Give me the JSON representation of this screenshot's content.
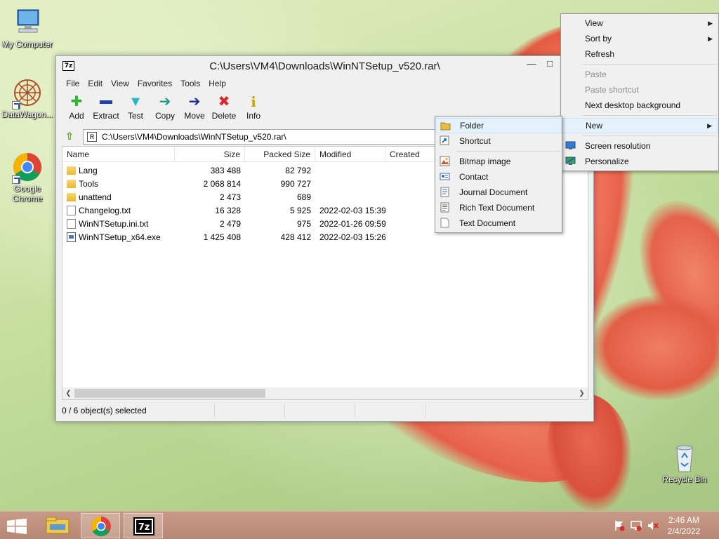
{
  "desktop": {
    "icons": [
      {
        "label": "My Computer"
      },
      {
        "label": "DataWagon..."
      },
      {
        "label": "Google Chrome"
      },
      {
        "label": "Recycle Bin"
      }
    ]
  },
  "window": {
    "title": "C:\\Users\\VM4\\Downloads\\WinNTSetup_v520.rar\\",
    "app_icon_text": "7z",
    "menu": [
      "File",
      "Edit",
      "View",
      "Favorites",
      "Tools",
      "Help"
    ],
    "toolbar": [
      {
        "label": "Add",
        "icon": "plus-icon",
        "color": "#2eb82e"
      },
      {
        "label": "Extract",
        "icon": "minus-icon",
        "color": "#1f3fb0"
      },
      {
        "label": "Test",
        "icon": "check-icon",
        "color": "#2ab7c0"
      },
      {
        "label": "Copy",
        "icon": "copy-arrow-icon",
        "color": "#1e9a86"
      },
      {
        "label": "Move",
        "icon": "move-arrow-icon",
        "color": "#1b2a8c"
      },
      {
        "label": "Delete",
        "icon": "x-icon",
        "color": "#d42a2a"
      },
      {
        "label": "Info",
        "icon": "info-icon",
        "color": "#c9a500"
      }
    ],
    "address": "C:\\Users\\VM4\\Downloads\\WinNTSetup_v520.rar\\",
    "columns": {
      "name": "Name",
      "size": "Size",
      "packed": "Packed Size",
      "modified": "Modified",
      "created": "Created"
    },
    "files": [
      {
        "name": "Lang",
        "type": "folder",
        "size": "383 488",
        "packed": "82 792",
        "modified": ""
      },
      {
        "name": "Tools",
        "type": "folder",
        "size": "2 068 814",
        "packed": "990 727",
        "modified": ""
      },
      {
        "name": "unattend",
        "type": "folder",
        "size": "2 473",
        "packed": "689",
        "modified": ""
      },
      {
        "name": "Changelog.txt",
        "type": "text",
        "size": "16 328",
        "packed": "5 925",
        "modified": "2022-02-03 15:39"
      },
      {
        "name": "WinNTSetup.ini.txt",
        "type": "text",
        "size": "2 479",
        "packed": "975",
        "modified": "2022-01-26 09:59"
      },
      {
        "name": "WinNTSetup_x64.exe",
        "type": "exe",
        "size": "1 425 408",
        "packed": "428 412",
        "modified": "2022-02-03 15:26"
      }
    ],
    "status": "0 / 6 object(s) selected"
  },
  "desktop_menu": {
    "items": [
      {
        "label": "View",
        "submenu": true,
        "disabled": false
      },
      {
        "label": "Sort by",
        "submenu": true,
        "disabled": false
      },
      {
        "label": "Refresh",
        "submenu": false,
        "disabled": false
      },
      {
        "sep": true
      },
      {
        "label": "Paste",
        "submenu": false,
        "disabled": true
      },
      {
        "label": "Paste shortcut",
        "submenu": false,
        "disabled": true
      },
      {
        "label": "Next desktop background",
        "submenu": false,
        "disabled": false
      },
      {
        "sep": true
      },
      {
        "label": "New",
        "submenu": true,
        "disabled": false,
        "highlighted": true
      },
      {
        "sep": true
      },
      {
        "label": "Screen resolution",
        "submenu": false,
        "disabled": false,
        "icon": "monitor-icon"
      },
      {
        "label": "Personalize",
        "submenu": false,
        "disabled": false,
        "icon": "personalize-icon"
      }
    ]
  },
  "new_menu": {
    "items": [
      {
        "label": "Folder",
        "icon": "folder-icon",
        "highlighted": true
      },
      {
        "label": "Shortcut",
        "icon": "shortcut-icon"
      },
      {
        "sep": true
      },
      {
        "label": "Bitmap image",
        "icon": "bitmap-icon"
      },
      {
        "label": "Contact",
        "icon": "contact-icon"
      },
      {
        "label": "Journal Document",
        "icon": "journal-icon"
      },
      {
        "label": "Rich Text Document",
        "icon": "richtext-icon"
      },
      {
        "label": "Text Document",
        "icon": "text-document-icon"
      }
    ]
  },
  "taskbar": {
    "clock_time": "2:46 AM",
    "clock_date": "2/4/2022"
  },
  "colors": {
    "accent": "#e5f1fb",
    "taskbar": "#c19482"
  }
}
